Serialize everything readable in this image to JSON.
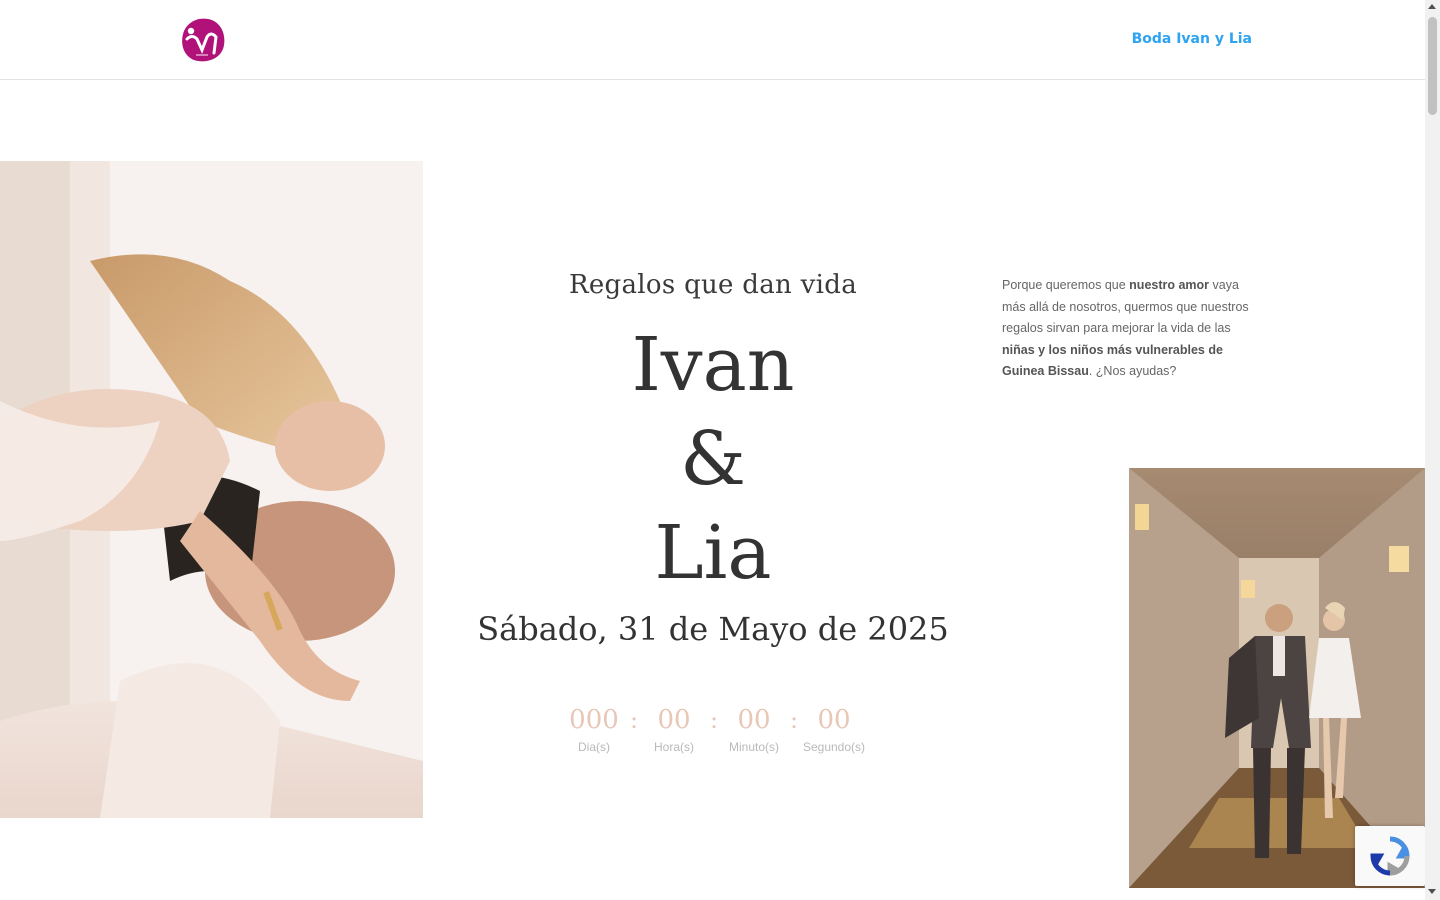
{
  "header": {
    "logo_icon": "heart-hands-logo-icon",
    "nav_link": "Boda Ivan y Lia",
    "brand_color": "#b0127a",
    "link_color": "#2ea3f2"
  },
  "hero": {
    "subtitle": "Regalos que dan vida",
    "name_1": "Ivan",
    "ampersand": "&",
    "name_2": "Lia",
    "date": "Sábado, 31 de Mayo de 2025"
  },
  "countdown": {
    "days": {
      "value": "000",
      "label": "Dia(s)"
    },
    "hours": {
      "value": "00",
      "label": "Hora(s)"
    },
    "minutes": {
      "value": "00",
      "label": "Minuto(s)"
    },
    "seconds": {
      "value": "00",
      "label": "Segundo(s)"
    },
    "separator": ":",
    "accent_color": "#e8c7b8"
  },
  "intro": {
    "t1": "Porque queremos que ",
    "b1": "nuestro amor",
    "t2": " vaya más allá de nosotros, quermos que nuestros regalos sirvan para mejorar la vida de las ",
    "b2": "niñas y los niños más vulnerables de Guinea Bissau",
    "t3": ". ¿Nos ayudas?"
  },
  "images": {
    "left_photo": "couple-embracing-photo",
    "right_photo": "couple-running-hallway-photo"
  },
  "widgets": {
    "recaptcha_icon": "recaptcha-icon"
  }
}
